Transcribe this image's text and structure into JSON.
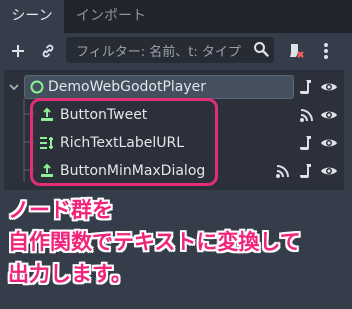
{
  "tabs": [
    {
      "label": "シーン",
      "active": true
    },
    {
      "label": "インポート",
      "active": false
    }
  ],
  "toolbar": {
    "add_icon": "plus-icon",
    "link_icon": "link-icon",
    "filter_placeholder": "フィルター: 名前、t: タイプ",
    "filter_icon": "magnifier-icon",
    "remote_icon": "remote-scene-icon",
    "menu_icon": "kebab-menu-icon"
  },
  "tree": {
    "root": {
      "label": "DemoWebGodotPlayer",
      "icon": "node-circle-icon",
      "badges": [
        "script-icon",
        "eye-icon"
      ]
    },
    "children": [
      {
        "label": "ButtonTweet",
        "icon": "button-node-icon",
        "badges": [
          "signal-icon",
          "eye-icon"
        ]
      },
      {
        "label": "RichTextLabelURL",
        "icon": "richtext-node-icon",
        "badges": [
          "script-icon",
          "eye-icon"
        ]
      },
      {
        "label": "ButtonMinMaxDialog",
        "icon": "button-node-icon",
        "badges": [
          "signal-icon",
          "script-icon",
          "eye-icon"
        ]
      }
    ]
  },
  "annotation": {
    "line1": "ノード群を",
    "line2": "自作関数でテキストに変換して",
    "line3": "出力します。"
  },
  "colors": {
    "panel_bg": "#363d4a",
    "tree_bg": "#2b303a",
    "accent_green": "#8eef97",
    "annotation_pink": "#f0247a"
  }
}
